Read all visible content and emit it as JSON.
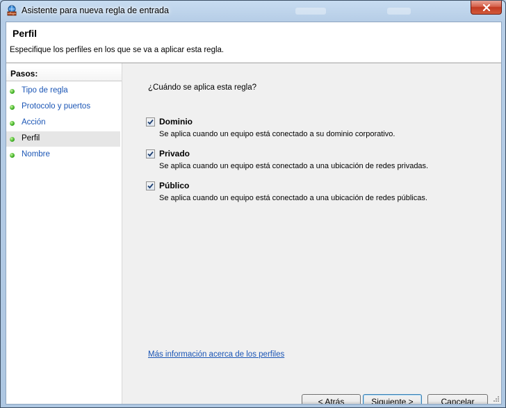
{
  "window": {
    "title": "Asistente para nueva regla de entrada",
    "close_icon": "close-icon",
    "app_icon": "firewall-icon"
  },
  "header": {
    "title": "Perfil",
    "description": "Especifique los perfiles en los que se va a aplicar esta regla."
  },
  "sidebar": {
    "steps_label": "Pasos:",
    "items": [
      {
        "label": "Tipo de regla",
        "active": false
      },
      {
        "label": "Protocolo y puertos",
        "active": false
      },
      {
        "label": "Acción",
        "active": false
      },
      {
        "label": "Perfil",
        "active": true
      },
      {
        "label": "Nombre",
        "active": false
      }
    ]
  },
  "main": {
    "question": "¿Cuándo se aplica esta regla?",
    "options": [
      {
        "title": "Dominio",
        "description": "Se aplica cuando un equipo está conectado a su dominio corporativo.",
        "checked": true
      },
      {
        "title": "Privado",
        "description": "Se aplica cuando un equipo está conectado a una ubicación de redes privadas.",
        "checked": true
      },
      {
        "title": "Público",
        "description": "Se aplica cuando un equipo está conectado a una ubicación de redes públicas.",
        "checked": true
      }
    ],
    "more_info_link": "Más información acerca de los perfiles"
  },
  "buttons": {
    "back": "< Atrás",
    "next": "Siguiente >",
    "cancel": "Cancelar"
  }
}
